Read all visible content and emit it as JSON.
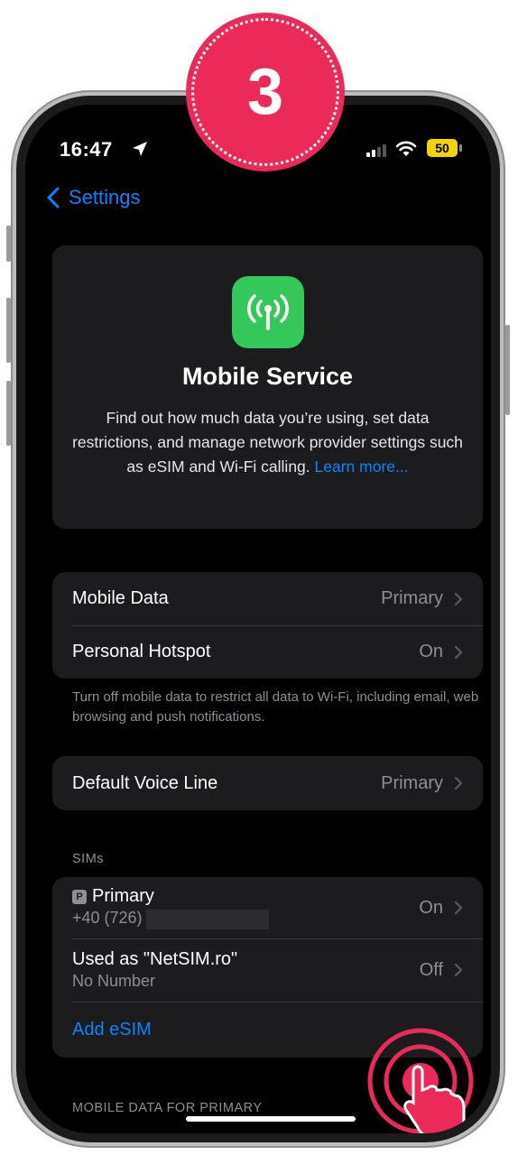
{
  "step_number": "3",
  "status_bar": {
    "time": "16:47",
    "battery": "50"
  },
  "nav": {
    "back_label": "Settings"
  },
  "hero": {
    "title": "Mobile Service",
    "description": "Find out how much data you’re using, set data restrictions, and manage network provider settings such as eSIM and Wi-Fi calling.",
    "link": "Learn more..."
  },
  "data_group": {
    "rows": [
      {
        "label": "Mobile Data",
        "value": "Primary"
      },
      {
        "label": "Personal Hotspot",
        "value": "On"
      }
    ],
    "footnote": "Turn off mobile data to restrict all data to Wi-Fi, including email, web browsing and push notifications."
  },
  "voice_group": {
    "label": "Default Voice Line",
    "value": "Primary"
  },
  "sims": {
    "header": "SIMs",
    "primary": {
      "badge": "P",
      "label": "Primary",
      "number": "+40 (726)",
      "value": "On"
    },
    "secondary": {
      "label": "Used as \"NetSIM.ro\"",
      "sublabel": "No Number",
      "value": "Off"
    },
    "add_esim": "Add eSIM"
  },
  "footer_section_header": "MOBILE DATA FOR PRIMARY",
  "colors": {
    "accent": "#0a84ff",
    "badge": "#ec2a5a",
    "app_icon": "#34c759",
    "battery": "#f2d20a"
  }
}
